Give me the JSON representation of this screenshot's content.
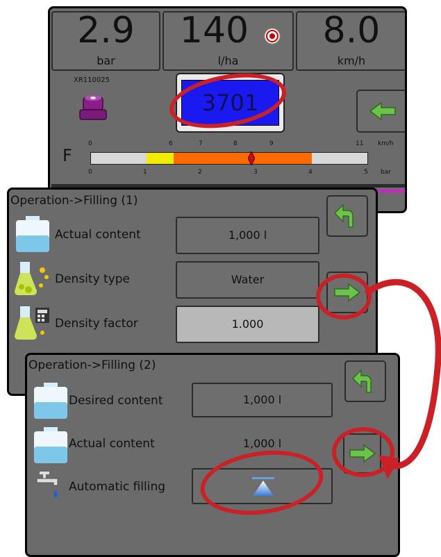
{
  "top_panel": {
    "pressure": {
      "value": "2.9",
      "unit": "bar"
    },
    "rate": {
      "value": "140",
      "unit": "l/ha",
      "target_icon": "target-icon"
    },
    "speed": {
      "value": "8.0",
      "unit": "km/h"
    },
    "nozzle": {
      "name": "XR110025",
      "icon": "nozzle-icon",
      "color": "#8b1e8b"
    },
    "counter_value": "3701",
    "counter_color": "#1a1af0",
    "back_button_icon": "arrow-left-icon",
    "scale": {
      "letter": "F",
      "top_ticks": [
        "0",
        "6",
        "7",
        "8",
        "9",
        "11"
      ],
      "bottom_ticks": [
        "0",
        "1",
        "2",
        "3",
        "4",
        "5"
      ],
      "top_unit": "km/h",
      "bottom_unit": "bar",
      "yellow_range_bar": [
        1,
        1.5
      ],
      "orange_range_bar": [
        1.5,
        4
      ],
      "indicator_bar": 2.9
    }
  },
  "filling1": {
    "title": "Operation->Filling (1)",
    "rows": [
      {
        "label": "Actual content",
        "value": "1,000 l",
        "icon": "tank-icon"
      },
      {
        "label": "Density type",
        "value": "Water",
        "icon": "flask-icon"
      },
      {
        "label": "Density factor",
        "value": "1.000",
        "icon": "calculator-flask-icon"
      }
    ],
    "back_icon": "return-arrow-icon",
    "next_icon": "arrow-right-icon"
  },
  "filling2": {
    "title": "Operation->Filling (2)",
    "rows": [
      {
        "label": "Desired content",
        "value": "1,000 l",
        "icon": "tank-icon"
      },
      {
        "label": "Actual content",
        "value": "1,000 l",
        "icon": "tank-icon"
      },
      {
        "label": "Automatic filling",
        "icon": "faucet-icon",
        "button_icon": "fill-level-icon"
      }
    ],
    "back_icon": "return-arrow-icon",
    "next_icon": "arrow-right-icon"
  },
  "annotation_color": "#cc2027"
}
